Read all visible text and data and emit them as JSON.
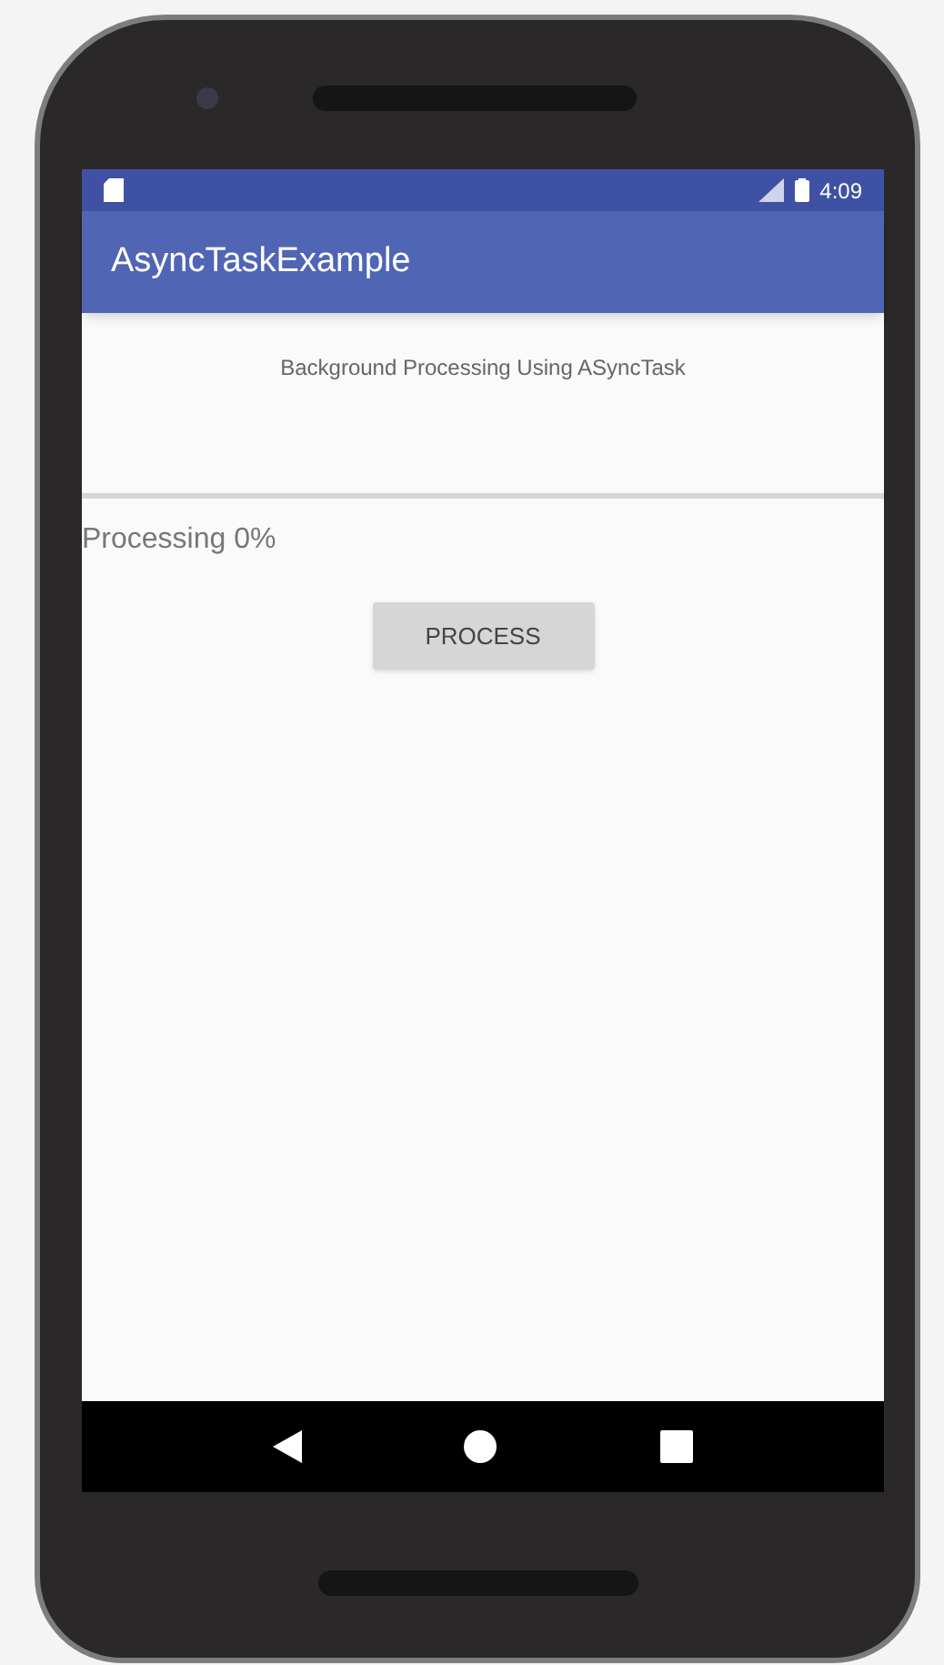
{
  "status_bar": {
    "time": "4:09"
  },
  "app_bar": {
    "title": "AsyncTaskExample"
  },
  "heading": "Background Processing Using ASyncTask",
  "progress": {
    "level": 0
  },
  "progress_label": "Processing 0%",
  "button": {
    "label": "PROCESS"
  },
  "nav_bar": [
    {
      "kind": "back"
    },
    {
      "kind": "home"
    },
    {
      "kind": "recents"
    }
  ]
}
